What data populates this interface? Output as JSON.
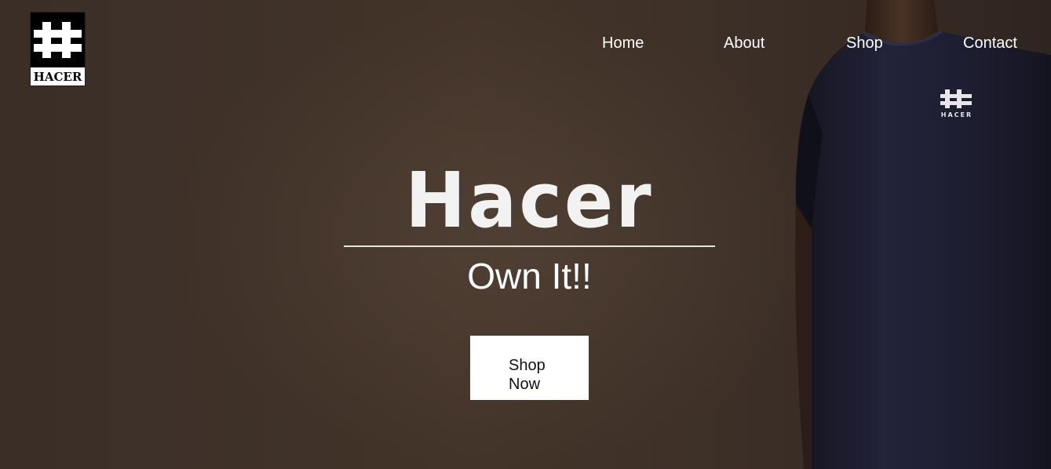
{
  "brand": {
    "logo_text": "HACER"
  },
  "nav": {
    "items": [
      {
        "label": "Home"
      },
      {
        "label": "About"
      },
      {
        "label": "Shop"
      },
      {
        "label": "Contact"
      }
    ]
  },
  "hero": {
    "title": "Hacer",
    "subtitle": "Own It!!",
    "cta_label": "Shop Now"
  },
  "colors": {
    "background": "#3e3129",
    "shirt": "#1c1c2b",
    "text": "#ffffff",
    "button_bg": "#ffffff"
  },
  "icons": {
    "logo_mark": "double-cross-hash-icon"
  }
}
